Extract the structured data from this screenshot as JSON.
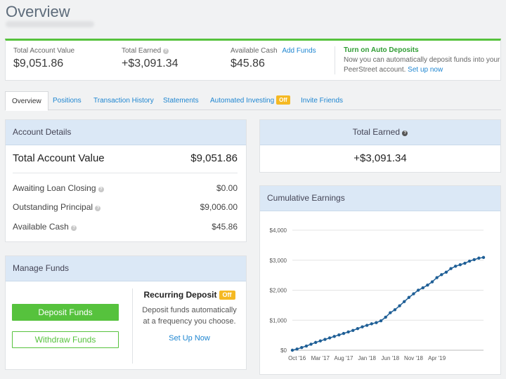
{
  "page": {
    "title": "Overview"
  },
  "summary": {
    "total_account_value_label": "Total Account Value",
    "total_account_value": "$9,051.86",
    "total_earned_label": "Total Earned",
    "total_earned": "+$3,091.34",
    "available_cash_label": "Available Cash",
    "available_cash": "$45.86",
    "add_funds_label": "Add Funds",
    "auto_deposits_title": "Turn on Auto Deposits",
    "auto_deposits_text_1": "Now you can automatically deposit funds into your",
    "auto_deposits_text_2": "PeerStreet account.",
    "auto_deposits_link": "Set up now"
  },
  "tabs": [
    {
      "label": "Overview"
    },
    {
      "label": "Positions"
    },
    {
      "label": "Transaction History"
    },
    {
      "label": "Statements"
    },
    {
      "label": "Automated Investing",
      "badge": "Off"
    },
    {
      "label": "Invite Friends"
    }
  ],
  "account_details": {
    "header": "Account Details",
    "total_label": "Total Account Value",
    "total_value": "$9,051.86",
    "rows": [
      {
        "label": "Awaiting Loan Closing",
        "value": "$0.00"
      },
      {
        "label": "Outstanding Principal",
        "value": "$9,006.00"
      },
      {
        "label": "Available Cash",
        "value": "$45.86"
      }
    ]
  },
  "total_earned_card": {
    "header": "Total Earned",
    "value": "+$3,091.34"
  },
  "manage_funds": {
    "header": "Manage Funds",
    "deposit_label": "Deposit Funds",
    "withdraw_label": "Withdraw Funds",
    "recurring_title": "Recurring Deposit",
    "recurring_badge": "Off",
    "recurring_text_1": "Deposit funds automatically",
    "recurring_text_2": "at a frequency you choose.",
    "setup_link": "Set Up Now"
  },
  "colors": {
    "accent_green": "#56c23d",
    "link_blue": "#1f86d1",
    "badge_orange": "#f5b923",
    "card_header_blue": "#dbe8f6",
    "series_blue": "#1f5f96"
  },
  "icons": {
    "help": "question-circle-icon"
  },
  "chart_data": {
    "type": "line",
    "title": "Cumulative Earnings",
    "xlabel": "",
    "ylabel": "",
    "ylim": [
      0,
      4000
    ],
    "y_ticks": [
      0,
      1000,
      2000,
      3000,
      4000
    ],
    "y_tick_labels": [
      "$0",
      "$1,000",
      "$2,000",
      "$3,000",
      "$4,000"
    ],
    "x_tick_labels": [
      "Oct '16",
      "Mar '17",
      "Aug '17",
      "Jan '18",
      "Jun '18",
      "Nov '18",
      "Apr '19"
    ],
    "x_tick_index": [
      1,
      6,
      11,
      16,
      21,
      26,
      31
    ],
    "grid": true,
    "series": [
      {
        "values": [
          0,
          40,
          90,
          140,
          200,
          260,
          310,
          360,
          410,
          460,
          510,
          560,
          610,
          660,
          720,
          780,
          830,
          880,
          920,
          980,
          1100,
          1250,
          1350,
          1480,
          1620,
          1760,
          1880,
          2000,
          2080,
          2170,
          2280,
          2420,
          2520,
          2600,
          2720,
          2800,
          2850,
          2900,
          2970,
          3020,
          3070,
          3091
        ]
      }
    ]
  }
}
